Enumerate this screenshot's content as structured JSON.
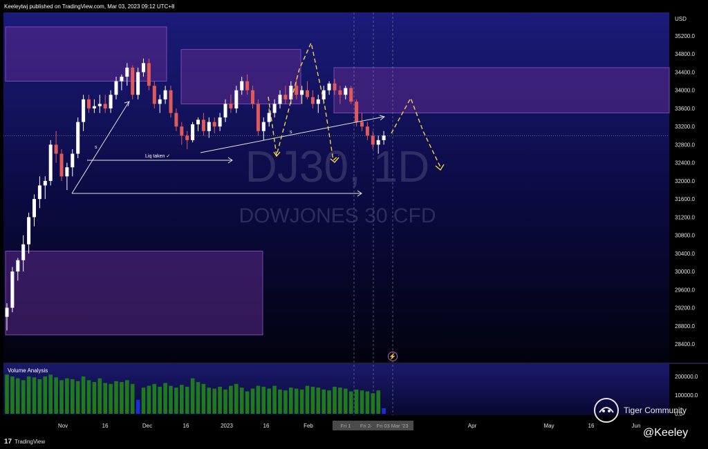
{
  "header": {
    "published_by": "Keeleytwj published on TradingView.com, Mar 03, 2023 09:12 UTC+8"
  },
  "footer": {
    "brand": "TradingView",
    "community": "Tiger Community",
    "handle": "@Keeley"
  },
  "chart_data": {
    "type": "candlestick",
    "symbol_watermark": "DJ30, 1D",
    "description_watermark": "DOWJONES 30 CFD",
    "currency": "USD",
    "y_ticks": [
      35200,
      34800,
      34400,
      34000,
      33600,
      33200,
      32800,
      32400,
      32000,
      31600,
      31200,
      30800,
      30400,
      30000,
      29600,
      29200,
      28800,
      28400
    ],
    "ylim": [
      28000,
      35500
    ],
    "x_ticks": [
      "Nov",
      "16",
      "Dec",
      "16",
      "2023",
      "16",
      "Feb",
      "16",
      "Apr",
      "May",
      "16",
      "Jun"
    ],
    "highlighted_dates": [
      "Fri 17 Feb",
      "Fri 24 Feb",
      "Fri 03 Mar '23"
    ],
    "annotations": {
      "liq_taken": "Liq taken ✓",
      "s1": "s",
      "s2": "s"
    },
    "zones": [
      {
        "name": "supply-zone-1",
        "y_top": 35400,
        "y_bottom": 34200
      },
      {
        "name": "supply-zone-2",
        "y_top": 34900,
        "y_bottom": 33700
      },
      {
        "name": "supply-zone-3",
        "y_top": 34500,
        "y_bottom": 33500
      },
      {
        "name": "demand-zone",
        "y_top": 30450,
        "y_bottom": 28600
      }
    ],
    "candles": [
      [
        29000,
        29300,
        28700,
        29200
      ],
      [
        29200,
        30100,
        29100,
        30000
      ],
      [
        30000,
        30300,
        29800,
        30250
      ],
      [
        30250,
        30800,
        30000,
        30600
      ],
      [
        30600,
        31300,
        30400,
        31200
      ],
      [
        31200,
        31700,
        31000,
        31600
      ],
      [
        31600,
        32100,
        31400,
        31900
      ],
      [
        31900,
        32100,
        31600,
        32000
      ],
      [
        32000,
        32900,
        31900,
        32800
      ],
      [
        32800,
        33100,
        32400,
        32600
      ],
      [
        32600,
        32700,
        32000,
        32100
      ],
      [
        32100,
        32400,
        31800,
        32300
      ],
      [
        32300,
        32700,
        32100,
        32600
      ],
      [
        32600,
        33400,
        32500,
        33300
      ],
      [
        33300,
        33900,
        33100,
        33800
      ],
      [
        33800,
        33900,
        33500,
        33600
      ],
      [
        33600,
        33800,
        33500,
        33650
      ],
      [
        33650,
        33900,
        33500,
        33700
      ],
      [
        33700,
        33900,
        33500,
        33600
      ],
      [
        33600,
        34000,
        33500,
        33900
      ],
      [
        33900,
        34300,
        33800,
        34200
      ],
      [
        34200,
        34350,
        34000,
        34300
      ],
      [
        34300,
        34600,
        34100,
        34500
      ],
      [
        34500,
        34550,
        33800,
        33900
      ],
      [
        33900,
        34500,
        33800,
        34400
      ],
      [
        34400,
        34700,
        34300,
        34600
      ],
      [
        34600,
        34700,
        34000,
        34100
      ],
      [
        34100,
        34200,
        33600,
        33700
      ],
      [
        33700,
        33900,
        33500,
        33800
      ],
      [
        33800,
        34100,
        33700,
        34000
      ],
      [
        34000,
        34100,
        33400,
        33500
      ],
      [
        33500,
        33600,
        33100,
        33200
      ],
      [
        33200,
        33300,
        32800,
        33000
      ],
      [
        33000,
        33100,
        32700,
        32900
      ],
      [
        32900,
        33300,
        32850,
        33250
      ],
      [
        33250,
        33400,
        33100,
        33350
      ],
      [
        33350,
        33500,
        33000,
        33100
      ],
      [
        33100,
        33400,
        32950,
        33300
      ],
      [
        33300,
        33400,
        33050,
        33200
      ],
      [
        33200,
        33500,
        33100,
        33400
      ],
      [
        33400,
        33800,
        33300,
        33700
      ],
      [
        33700,
        33900,
        33500,
        33600
      ],
      [
        33600,
        34100,
        33500,
        34000
      ],
      [
        34000,
        34300,
        33900,
        34200
      ],
      [
        34200,
        34350,
        33900,
        34000
      ],
      [
        34000,
        34100,
        33600,
        33700
      ],
      [
        33700,
        33800,
        33000,
        33100
      ],
      [
        33100,
        33400,
        32900,
        33300
      ],
      [
        33300,
        33600,
        33200,
        33500
      ],
      [
        33500,
        33800,
        33400,
        33700
      ],
      [
        33700,
        34000,
        33600,
        33900
      ],
      [
        33900,
        34100,
        33700,
        33800
      ],
      [
        33800,
        34200,
        33700,
        34100
      ],
      [
        34100,
        34250,
        33800,
        33900
      ],
      [
        33900,
        34100,
        33700,
        34000
      ],
      [
        34000,
        34200,
        33800,
        33850
      ],
      [
        33850,
        34000,
        33600,
        33700
      ],
      [
        33700,
        33900,
        33500,
        33800
      ],
      [
        33800,
        34100,
        33700,
        34000
      ],
      [
        34000,
        34200,
        33900,
        34150
      ],
      [
        34150,
        34250,
        33900,
        34000
      ],
      [
        34000,
        34100,
        33700,
        33900
      ],
      [
        33900,
        34100,
        33800,
        34050
      ],
      [
        34050,
        34100,
        33700,
        33750
      ],
      [
        33750,
        33800,
        33200,
        33300
      ],
      [
        33300,
        33500,
        33100,
        33200
      ],
      [
        33200,
        33300,
        32900,
        33000
      ],
      [
        33000,
        33100,
        32700,
        32800
      ],
      [
        32800,
        33000,
        32600,
        32900
      ],
      [
        32900,
        33100,
        32800,
        33000
      ]
    ],
    "volume_panel": {
      "label": "Volume Analysis",
      "y_ticks": [
        200000.0,
        100000.0,
        0.0
      ],
      "y_tick_labels": [
        "200000.0",
        "100000.0",
        "0.0"
      ],
      "ylim": [
        0,
        250000
      ],
      "volumes": [
        210000,
        200000,
        190000,
        180000,
        200000,
        195000,
        185000,
        200000,
        210000,
        195000,
        180000,
        190000,
        185000,
        175000,
        200000,
        180000,
        170000,
        190000,
        165000,
        160000,
        175000,
        170000,
        180000,
        160000,
        75000,
        140000,
        150000,
        160000,
        145000,
        165000,
        150000,
        140000,
        155000,
        145000,
        190000,
        170000,
        160000,
        140000,
        135000,
        145000,
        130000,
        150000,
        160000,
        140000,
        120000,
        135000,
        150000,
        145000,
        135000,
        150000,
        130000,
        125000,
        140000,
        135000,
        130000,
        150000,
        145000,
        140000,
        130000,
        125000,
        145000,
        140000,
        135000,
        120000,
        130000,
        125000,
        120000,
        110000,
        125000,
        30000
      ],
      "highlight_bars": [
        24,
        69
      ],
      "colors": {
        "up": "#1f7a1f",
        "highlight": "#1a2fd6"
      }
    },
    "colors": {
      "up": "#ffffff",
      "down": "#e05a5a",
      "zone_fill": "#5b2a8a",
      "zone_border": "#8e56c9",
      "projection": "#f2d64b",
      "arrow": "#e6e6e6"
    }
  }
}
